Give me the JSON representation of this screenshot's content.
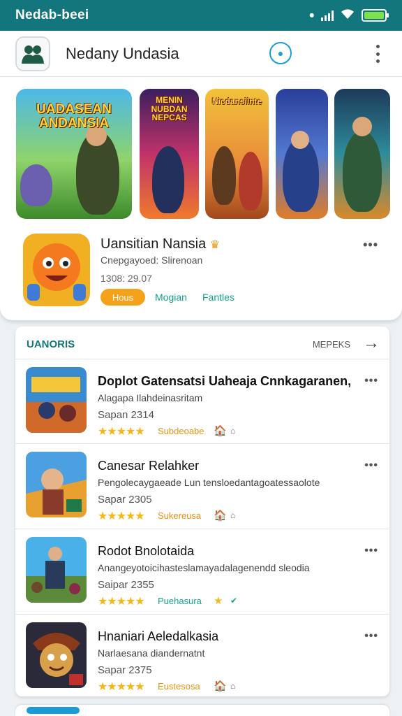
{
  "status_bar": {
    "title": "Nedab-beei"
  },
  "app_bar": {
    "title": "Nedany Undasia"
  },
  "featured": {
    "banners": [
      {
        "text": "UADASEAN ANDANSIA"
      },
      {
        "text": "MENIN NUBDAN NEPCAS"
      },
      {
        "text": "Nicdansiinte"
      },
      {
        "text": ""
      },
      {
        "text": ""
      }
    ],
    "title": "Uansitian Nansia",
    "subtitle": "Cnepgayoed: Slirenoan",
    "date": "1308: 29.07",
    "badge": "Hous",
    "link1": "Mogian",
    "link2": "Fantles"
  },
  "list": {
    "title": "UANORIS",
    "more": "MEPEKS",
    "items": [
      {
        "title": "Doplot Gatensatsi Uaheaja Cnnkagaranen,",
        "subtitle": "Alagapa Ilahdeinasritam",
        "date": "Sapan 2314",
        "stars": "★★★★★",
        "category": "Subdeoabe",
        "cat_color": "#e39412"
      },
      {
        "title": "Canesar Relahker",
        "subtitle": "Pengolecaygaeade Lun tensloedantagoatessaolote",
        "date": "Sapar 2305",
        "stars": "★★★★★",
        "category": "Sukereusa",
        "cat_color": "#e39412"
      },
      {
        "title": "Rodot Bnolotaida",
        "subtitle": "Anangeyotoicihasteslamayadalagenendd sleodia",
        "date": "Saipar 2355",
        "stars": "★★★★★",
        "category": "Puehasura",
        "cat_color": "#12a28a"
      },
      {
        "title": "Hnaniari Aeledalkasia",
        "subtitle": "Narlaesana diandernatnt",
        "date": "Sapar 2375",
        "stars": "★★★★★",
        "category": "Eustesosa",
        "cat_color": "#e39412"
      }
    ]
  }
}
